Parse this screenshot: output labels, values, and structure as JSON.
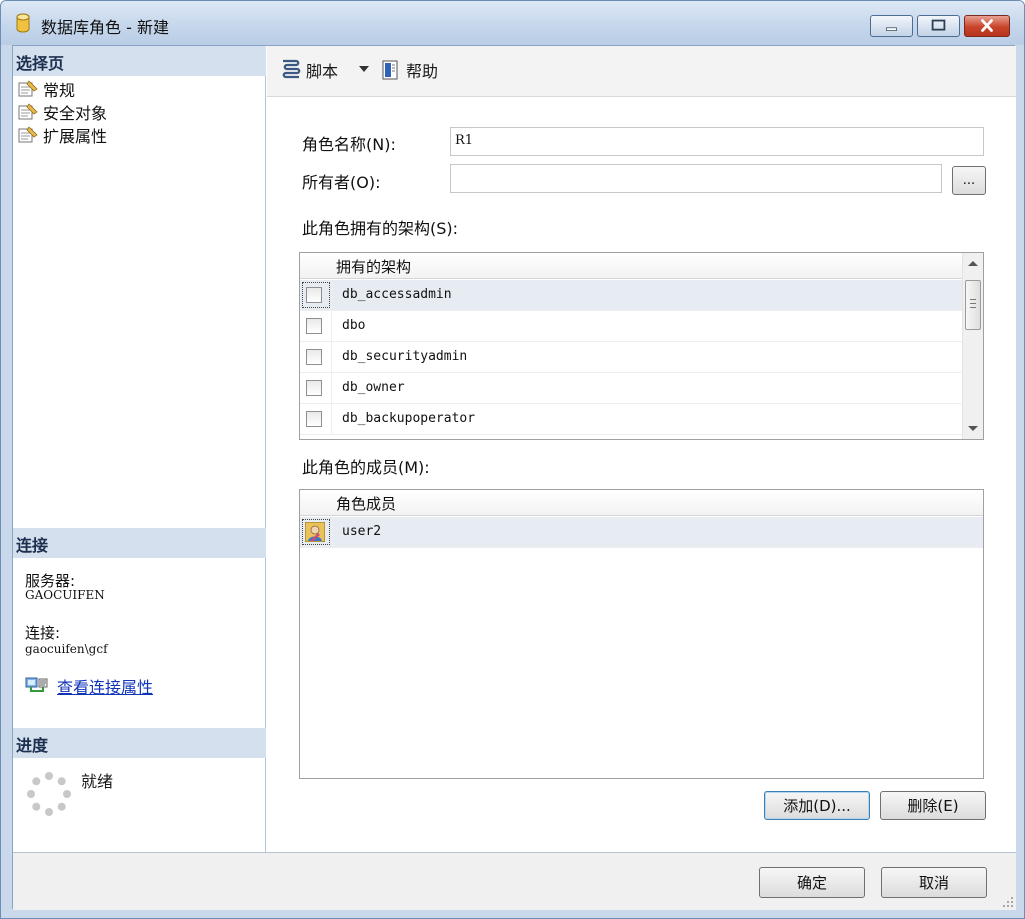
{
  "window": {
    "title": "数据库角色 - 新建"
  },
  "left": {
    "select_page_header": "选择页",
    "nav_items": [
      {
        "label": "常规"
      },
      {
        "label": "安全对象"
      },
      {
        "label": "扩展属性"
      }
    ],
    "connection_header": "连接",
    "server_label": "服务器:",
    "server_value": "GAOCUIFEN",
    "connection_label": "连接:",
    "connection_value": "gaocuifen\\gcf",
    "view_connection_link": "查看连接属性",
    "progress_header": "进度",
    "progress_status": "就绪"
  },
  "toolbar": {
    "script_label": "脚本",
    "help_label": "帮助"
  },
  "form": {
    "role_name_label": "角色名称(N):",
    "role_name_value": "R1",
    "owner_label": "所有者(O):",
    "owner_value": "",
    "browse_label": "...",
    "schemas_label": "此角色拥有的架构(S):",
    "members_label": "此角色的成员(M):"
  },
  "schemas": {
    "column_header": "拥有的架构",
    "rows": [
      {
        "name": "db_accessadmin",
        "checked": false
      },
      {
        "name": "dbo",
        "checked": false
      },
      {
        "name": "db_securityadmin",
        "checked": false
      },
      {
        "name": "db_owner",
        "checked": false
      },
      {
        "name": "db_backupoperator",
        "checked": false
      }
    ]
  },
  "members": {
    "column_header": "角色成员",
    "rows": [
      {
        "name": "user2"
      }
    ],
    "add_label": "添加(D)...",
    "remove_label": "删除(E)"
  },
  "footer": {
    "ok_label": "确定",
    "cancel_label": "取消"
  }
}
